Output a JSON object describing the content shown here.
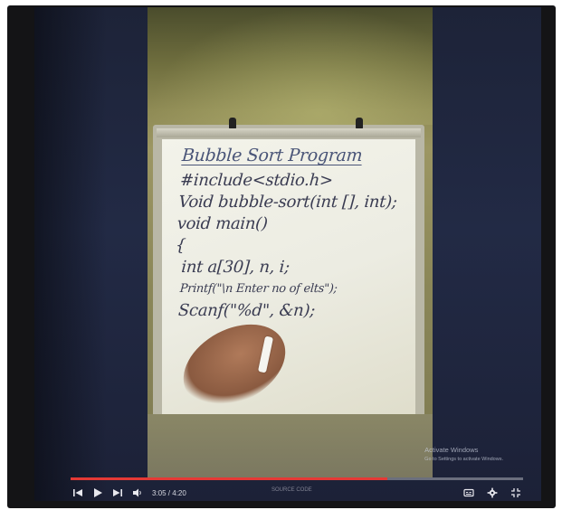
{
  "board": {
    "lines": [
      "Bubble Sort Program",
      "#include<stdio.h>",
      "Void bubble-sort(int [], int);",
      "void main()",
      "{",
      "int a[30], n, i;",
      "Printf(\"\\n Enter no of elts\");",
      "Scanf(\"%d\", &n);"
    ]
  },
  "player": {
    "time": "3:05 / 4:20",
    "progress": 0.7,
    "title": "SOURCE CODE"
  },
  "watermark": {
    "title": "Activate Windows",
    "subtitle": "Go to Settings to activate Windows."
  },
  "icons": {
    "prev": "skip-previous-icon",
    "play": "play-icon",
    "next": "skip-next-icon",
    "volume": "volume-icon",
    "captions": "captions-icon",
    "settings": "settings-icon",
    "fullscreen": "exit-fullscreen-icon"
  },
  "colors": {
    "progress": "#e53935"
  }
}
